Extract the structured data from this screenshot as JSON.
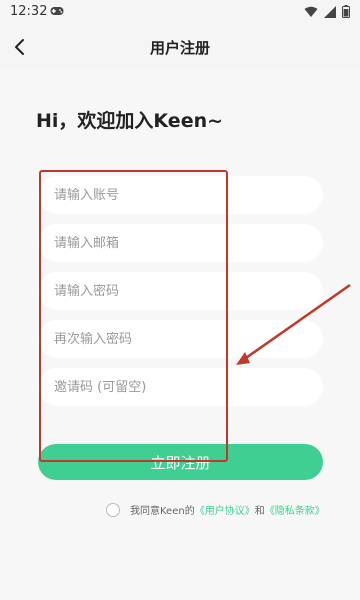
{
  "status_bar": {
    "time": "12:32"
  },
  "nav": {
    "title": "用户注册"
  },
  "greeting": "Hi，欢迎加入Keen~",
  "form": {
    "account_placeholder": "请输入账号",
    "email_placeholder": "请输入邮箱",
    "password_placeholder": "请输入密码",
    "confirm_placeholder": "再次输入密码",
    "invite_placeholder": "邀请码 (可留空)",
    "account_value": "",
    "email_value": "",
    "password_value": "",
    "confirm_value": "",
    "invite_value": ""
  },
  "submit_label": "立即注册",
  "agreement": {
    "prefix": "我同意Keen的",
    "user_agreement": "《用户协议》",
    "and": "和",
    "privacy_policy": "《隐私条款》"
  },
  "colors": {
    "accent": "#3fcf93",
    "annotation": "#c0392b"
  },
  "icons": {
    "back": "chevron-left-icon",
    "wifi": "wifi-icon",
    "signal": "signal-icon",
    "battery": "battery-icon",
    "gamepad": "gamepad-icon"
  }
}
